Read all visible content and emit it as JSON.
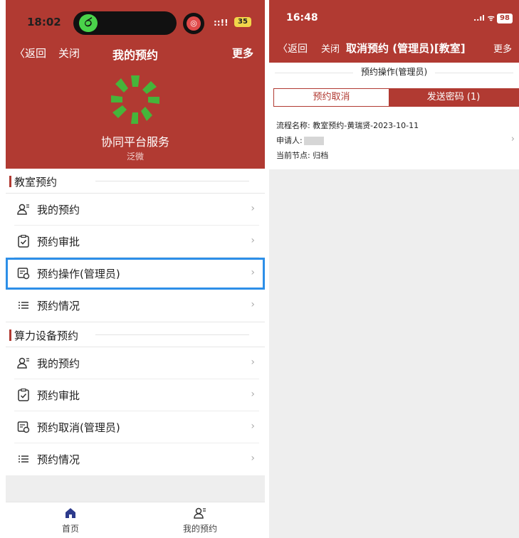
{
  "left": {
    "status": {
      "time": "18:02",
      "signal": "::!!",
      "battery": "35"
    },
    "nav": {
      "back": "〈返回",
      "close": "关闭",
      "title": "我的预约",
      "more": "更多"
    },
    "brand": {
      "name": "协同平台服务",
      "sub": "泛微"
    },
    "sections": [
      {
        "title": "教室预约",
        "items": [
          {
            "label": "我的预约",
            "icon": "user-icon"
          },
          {
            "label": "预约审批",
            "icon": "check-clipboard-icon"
          },
          {
            "label": "预约操作(管理员)",
            "icon": "admin-doc-icon",
            "selected": true
          },
          {
            "label": "预约情况",
            "icon": "list-icon"
          }
        ]
      },
      {
        "title": "算力设备预约",
        "items": [
          {
            "label": "我的预约",
            "icon": "user-icon"
          },
          {
            "label": "预约审批",
            "icon": "check-clipboard-icon"
          },
          {
            "label": "预约取消(管理员)",
            "icon": "admin-doc-icon"
          },
          {
            "label": "预约情况",
            "icon": "list-icon"
          }
        ]
      }
    ],
    "tabs": [
      {
        "label": "首页",
        "icon": "home-icon"
      },
      {
        "label": "我的预约",
        "icon": "user-icon"
      }
    ],
    "chevron": "›",
    "accent": "#b13a32",
    "highlight": "#2d8fe8"
  },
  "right": {
    "status": {
      "time": "16:48",
      "signal": "..ıl ᯤ",
      "battery": "98"
    },
    "nav": {
      "back": "〈返回",
      "close": "关闭",
      "title": "取消预约 (管理员)[教室]",
      "more": "更多"
    },
    "section": "预约操作(管理员)",
    "segments": {
      "left": "预约取消",
      "right": "发送密码 (1)"
    },
    "record": {
      "flow_label": "流程名称:",
      "flow_value": "教室预约-黄瑞贤-2023-10-11",
      "applicant_label": "申请人:",
      "node_label": "当前节点:",
      "node_value": "归档"
    }
  }
}
